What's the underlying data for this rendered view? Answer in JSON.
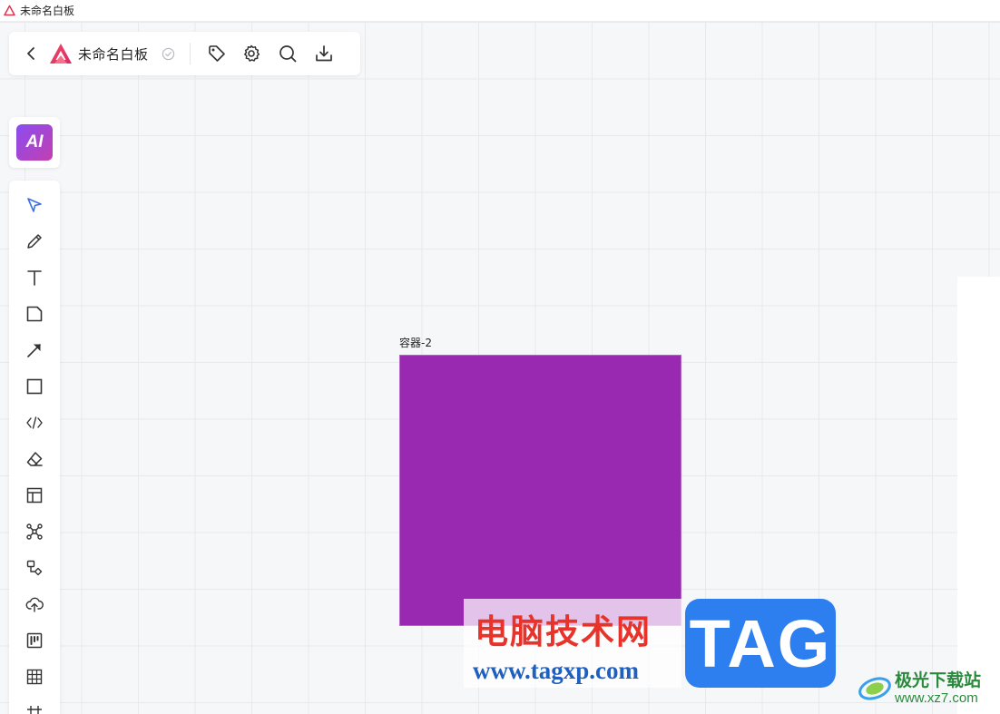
{
  "window": {
    "title": "未命名白板"
  },
  "header": {
    "doc_title": "未命名白板",
    "tools": [
      "tag-icon",
      "settings-icon",
      "search-icon",
      "download-icon"
    ]
  },
  "ai": {
    "label": "AI"
  },
  "toolbar": {
    "items": [
      "select-icon",
      "pen-icon",
      "text-icon",
      "sticky-note-icon",
      "arrow-icon",
      "rectangle-icon",
      "code-icon",
      "eraser-icon",
      "layout-icon",
      "mindmap-icon",
      "flowchart-icon",
      "upload-icon",
      "kanban-icon",
      "table-icon",
      "grid-icon"
    ]
  },
  "canvas": {
    "container": {
      "label": "容器-2",
      "fill": "#9a29b2"
    }
  },
  "watermark": {
    "cn": "电脑技术网",
    "url": "www.tagxp.com",
    "tag": "TAG",
    "site_name": "极光下载站",
    "site_url": "www.xz7.com"
  },
  "colors": {
    "accent": "#2d7ff0",
    "select_tool": "#3b6ee8",
    "container_fill": "#9a29b2",
    "ai_gradient": [
      "#8a4df0",
      "#c23fb0"
    ]
  }
}
